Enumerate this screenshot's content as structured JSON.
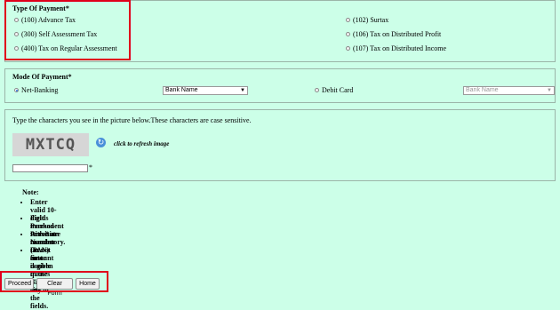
{
  "payment_type": {
    "heading": "Type Of Payment*",
    "options_left": [
      {
        "label": "(100) Advance Tax"
      },
      {
        "label": "(300) Self Assessment Tax"
      },
      {
        "label": "(400) Tax on Regular Assessment"
      }
    ],
    "options_right": [
      {
        "label": "(102) Surtax"
      },
      {
        "label": "(106) Tax on Distributed Profit"
      },
      {
        "label": "(107) Tax on Distributed Income"
      }
    ]
  },
  "payment_mode": {
    "heading": "Mode Of Payment*",
    "net_banking_label": "Net-Banking",
    "debit_card_label": "Debit Card",
    "bank_select_value": "Bank Name",
    "card_bank_select_value": "Bank Name"
  },
  "captcha": {
    "instruction": "Type the characters you see in the picture below.These characters are case sensitive.",
    "image_text": "MXTCQ",
    "refresh_text": "click to refresh image",
    "required_mark": "*"
  },
  "notes": {
    "heading": "Note:",
    "items": [
      "Enter valid 10-digit Permanent Account Number (PAN) first.",
      "Fields marked with * are mandatory.",
      "Provision to enter tax amount is given in the Bank's site.",
      "Do not enter double quotes (\"\") in any of the fields."
    ]
  },
  "buttons": {
    "proceed": "Proceed",
    "clear": "Clear Form",
    "home": "Home"
  },
  "colors": {
    "background": "#ccffe8",
    "highlight": "#e0001b",
    "radio_selected": "#2a6fd4"
  }
}
